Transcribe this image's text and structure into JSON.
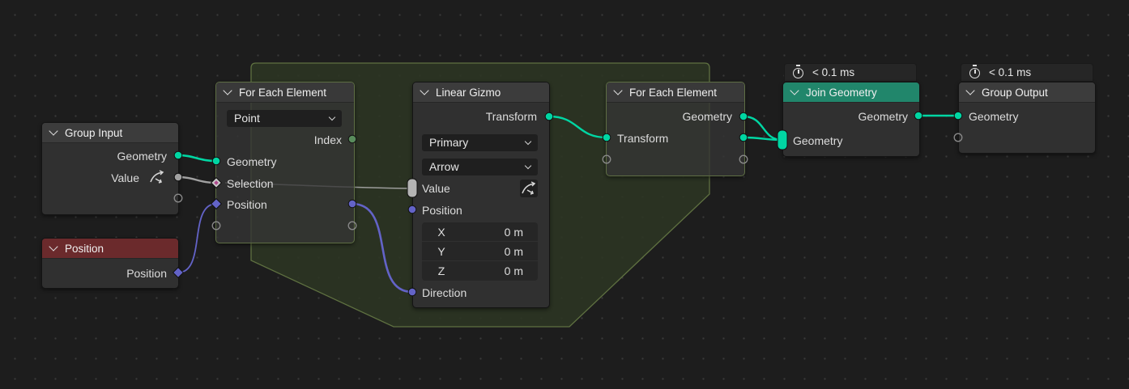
{
  "colors": {
    "geometry": "#00d6a3",
    "float": "#a1a1a1",
    "vector": "#6363c7",
    "integer": "#598c5c",
    "zone": "#5f7141",
    "header_red": "#6b2a2c",
    "header_green": "#21866b"
  },
  "group_input": {
    "title": "Group Input",
    "geometry_label": "Geometry",
    "value_label": "Value",
    "value_icon": "gizmo-arrow-icon"
  },
  "position_node": {
    "title": "Position",
    "position_label": "Position"
  },
  "for_each_input": {
    "title": "For Each Element",
    "domain": "Point",
    "index_label": "Index",
    "geometry_label": "Geometry",
    "selection_label": "Selection",
    "position_label": "Position"
  },
  "linear_gizmo": {
    "title": "Linear Gizmo",
    "transform_label": "Transform",
    "color_option": "Primary",
    "draw_style": "Arrow",
    "value_label": "Value",
    "position_label": "Position",
    "position_vector": [
      {
        "axis": "X",
        "value": "0 m"
      },
      {
        "axis": "Y",
        "value": "0 m"
      },
      {
        "axis": "Z",
        "value": "0 m"
      }
    ],
    "direction_label": "Direction"
  },
  "for_each_output": {
    "title": "For Each Element",
    "geometry_label": "Geometry",
    "transform_label": "Transform"
  },
  "join_geometry": {
    "timing": "< 0.1 ms",
    "title": "Join Geometry",
    "geometry_out_label": "Geometry",
    "geometry_in_label": "Geometry"
  },
  "group_output": {
    "timing": "< 0.1 ms",
    "title": "Group Output",
    "geometry_label": "Geometry"
  }
}
